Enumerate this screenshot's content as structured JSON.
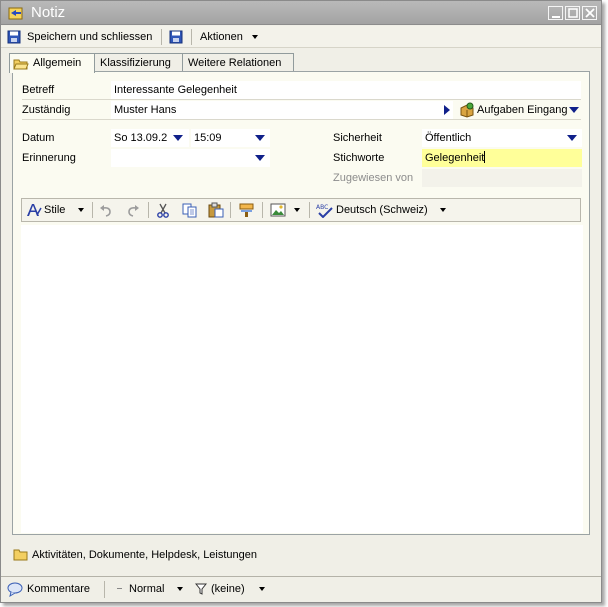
{
  "window": {
    "title": "Notiz"
  },
  "toolbar": {
    "save_close_label": "Speichern und schliessen",
    "actions_label": "Aktionen"
  },
  "tabs": [
    {
      "label": "Allgemein"
    },
    {
      "label": "Klassifizierung"
    },
    {
      "label": "Weitere Relationen"
    }
  ],
  "form": {
    "betreff_label": "Betreff",
    "betreff_value": "Interessante Gelegenheit",
    "zustaendig_label": "Zuständig",
    "zustaendig_value": "Muster Hans",
    "inbox_label": "Aufgaben Eingang",
    "datum_label": "Datum",
    "datum_value": "So 13.09.2",
    "time_value": "15:09",
    "erinnerung_label": "Erinnerung",
    "erinnerung_value": "",
    "sicherheit_label": "Sicherheit",
    "sicherheit_value": "Öffentlich",
    "stichworte_label": "Stichworte",
    "stichworte_value": "Gelegenheit",
    "zugewiesen_label": "Zugewiesen von",
    "zugewiesen_value": ""
  },
  "editor": {
    "style_label": "Stile",
    "language_label": "Deutsch (Schweiz)"
  },
  "bottom": {
    "link_label": "Aktivitäten, Dokumente, Helpdesk, Leistungen"
  },
  "status": {
    "comments_label": "Kommentare",
    "priority_label": "Normal",
    "filter_label": "(keine)"
  },
  "colors": {
    "highlight": "#ffff99",
    "panel": "#fbfbf1",
    "frame": "#f0efe7",
    "accent": "#10208a"
  }
}
